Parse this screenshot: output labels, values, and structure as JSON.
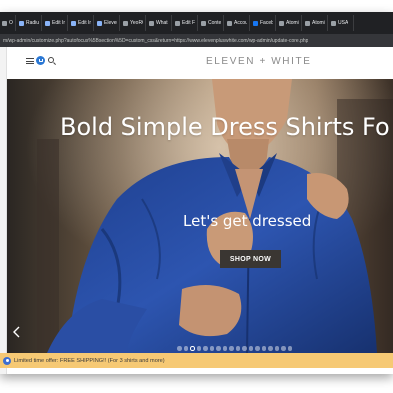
{
  "browser": {
    "tabs": [
      {
        "label": "Ocus",
        "icon": "page-icon"
      },
      {
        "label": "Radiu",
        "icon": "pin-icon"
      },
      {
        "label": "Edit In",
        "icon": "pin-icon"
      },
      {
        "label": "Edit In",
        "icon": "pin-icon"
      },
      {
        "label": "Eleven",
        "icon": "pin-icon"
      },
      {
        "label": "YeoRC",
        "icon": "page-icon"
      },
      {
        "label": "What",
        "icon": "page-icon"
      },
      {
        "label": "Edit Fi",
        "icon": "page-icon"
      },
      {
        "label": "Conte",
        "icon": "page-icon"
      },
      {
        "label": "Accou",
        "icon": "page-icon"
      },
      {
        "label": "Faceb",
        "icon": "facebook-icon"
      },
      {
        "label": "Atomi",
        "icon": "page-icon"
      },
      {
        "label": "Atomi",
        "icon": "page-icon"
      },
      {
        "label": "USA",
        "icon": "page-icon"
      }
    ],
    "url": "m/wp-admin/customize.php?autofocus%5Bsection%5D=custom_css&return=https://www.elevenpluswhite.com/wp-admin/update-core.php"
  },
  "site": {
    "logo": "ELEVEN + WHITE",
    "hero": {
      "heading": "Bold  Simple Dress Shirts Fo",
      "subheading": "Let's get dressed",
      "cta_label": "SHOP NOW"
    },
    "carousel": {
      "slide_count": 18,
      "active_index": 2
    },
    "announcement": "Limited time offer: FREE SHIPPING!! (For 3 shirts and more)"
  },
  "colors": {
    "accent_blue": "#2b78d4",
    "promo_bar": "#f6c974",
    "button_bg": "#3a3632",
    "shirt_blue": "#2a4fa0"
  }
}
